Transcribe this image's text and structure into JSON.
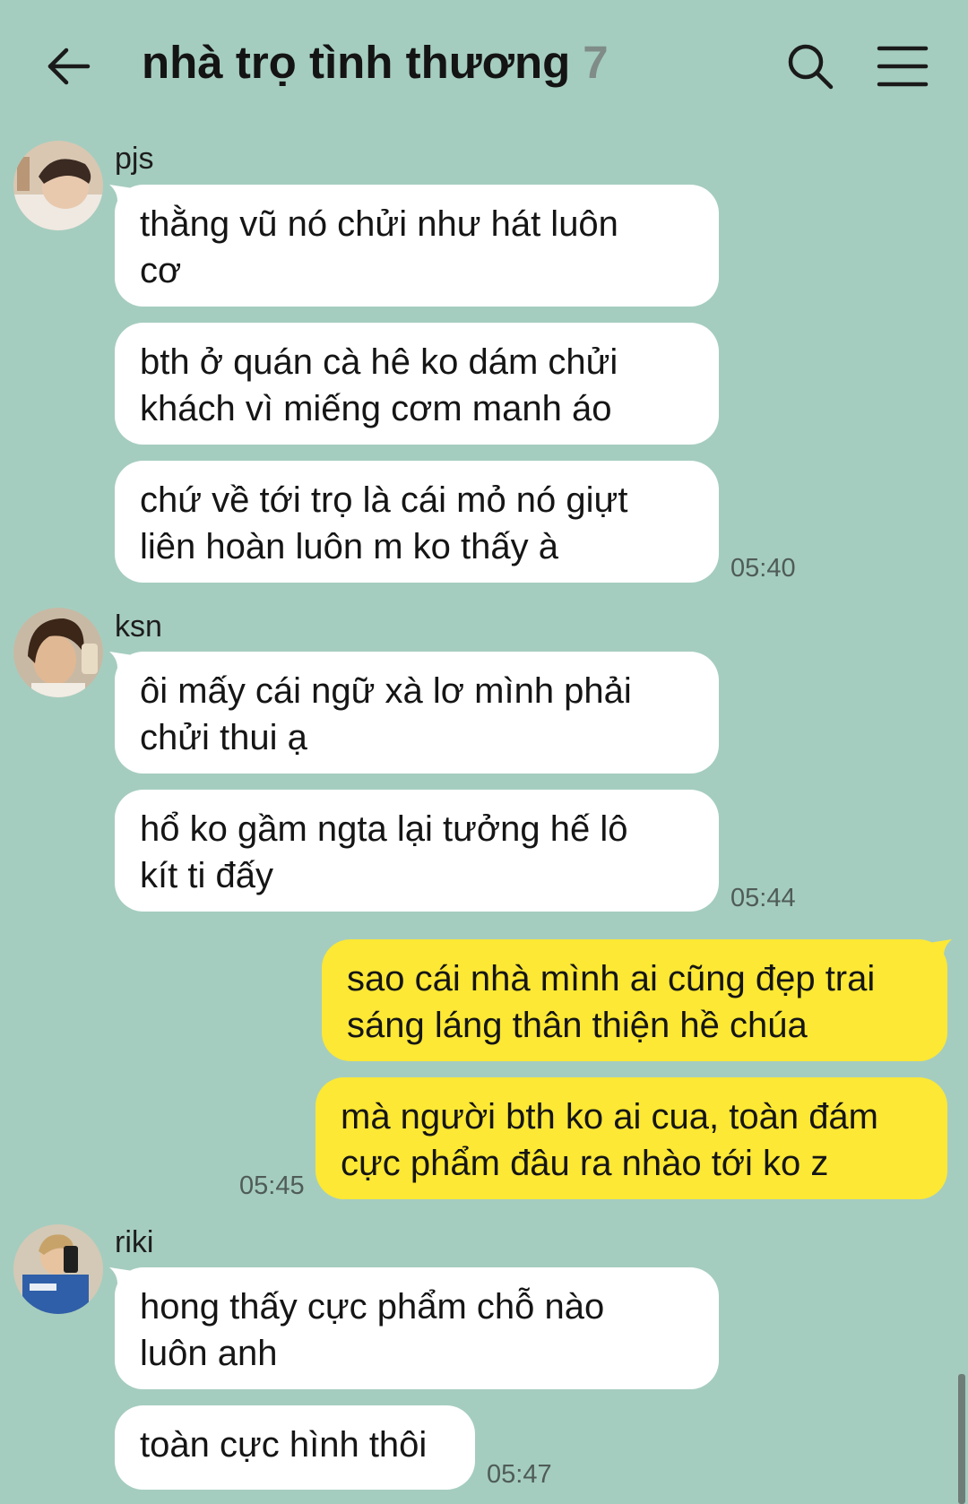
{
  "header": {
    "title": "nhà trọ tình thương",
    "member_count": "7"
  },
  "groups": [
    {
      "sender": "pjs",
      "messages": [
        [
          "thằng vũ nó chửi như hát luôn",
          "cơ"
        ],
        [
          "bth ở quán cà hê ko dám chửi",
          "khách vì miếng cơm manh áo"
        ],
        [
          "chứ về tới trọ là cái mỏ nó giựt",
          "liên hoàn luôn m ko thấy à"
        ]
      ],
      "time": "05:40"
    },
    {
      "sender": "ksn",
      "messages": [
        [
          "ôi mấy cái ngữ xà lơ mình phải",
          "chửi thui ạ"
        ],
        [
          "hổ ko gầm ngta lại tưởng hế lô",
          "kít ti đấy"
        ]
      ],
      "time": "05:44"
    },
    {
      "sender": "me",
      "messages": [
        [
          "sao cái nhà mình ai cũng đẹp trai",
          "sáng láng thân thiện hề chúa"
        ],
        [
          "mà người bth ko ai cua, toàn đám",
          "cực phẩm đâu ra nhào tới ko z"
        ]
      ],
      "time": "05:45"
    },
    {
      "sender": "riki",
      "messages": [
        [
          "hong thấy cực phẩm chỗ nào",
          "luôn anh"
        ],
        [
          "toàn cực hình thôi"
        ]
      ],
      "time": "05:47"
    }
  ],
  "colors": {
    "background": "#a5cdbf",
    "incoming_bubble": "#ffffff",
    "outgoing_bubble": "#fce835"
  },
  "icons": [
    "back-arrow-icon",
    "search-icon",
    "menu-icon"
  ]
}
